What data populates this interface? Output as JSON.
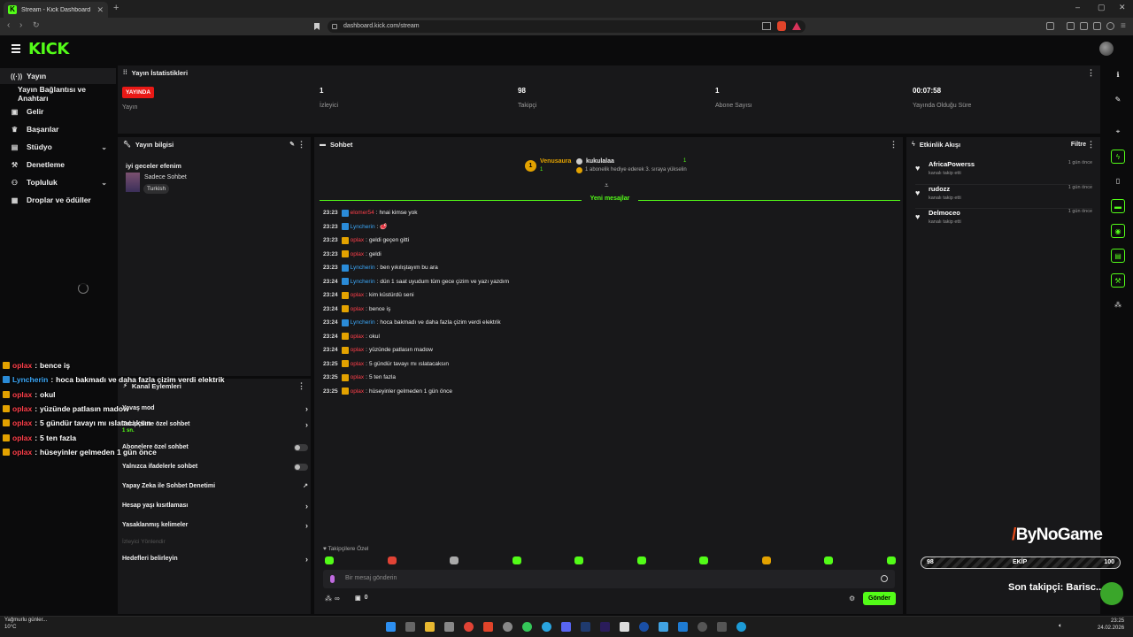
{
  "browser": {
    "tab_title": "Stream - Kick Dashboard",
    "tab_icon": "K",
    "url": "dashboard.kick.com/stream",
    "window_controls": [
      "–",
      "▢",
      "✕"
    ]
  },
  "header": {
    "logo_text": "KICK"
  },
  "sidebar": {
    "items": [
      {
        "label": "Yayın",
        "icon": "((·))"
      },
      {
        "label": "Yayın Bağlantısı ve Anahtarı"
      },
      {
        "label": "Gelir",
        "icon": "▣"
      },
      {
        "label": "Başarılar",
        "icon": "🏆"
      },
      {
        "label": "Stüdyo",
        "icon": "▤"
      },
      {
        "label": "Denetleme",
        "icon": "🔨"
      },
      {
        "label": "Topluluk",
        "icon": "👥"
      },
      {
        "label": "Droplar ve ödüller",
        "icon": "▦"
      }
    ]
  },
  "stats": {
    "title": "Yayın İstatistikleri",
    "live_badge": "YAYINDA",
    "items": [
      {
        "value": "",
        "label": "Yayın"
      },
      {
        "value": "1",
        "label": "İzleyici"
      },
      {
        "value": "98",
        "label": "Takipçi"
      },
      {
        "value": "1",
        "label": "Abone Sayısı"
      },
      {
        "value": "00:07:58",
        "label": "Yayında Olduğu Süre"
      }
    ]
  },
  "stream_info": {
    "title": "Yayın bilgisi",
    "stream_title": "iyi geceler efenim",
    "category": "Sadece Sohbet",
    "tag": "Turkish"
  },
  "actions": {
    "title": "Kanal Eylemleri",
    "items": [
      {
        "label": "Yavaş mod",
        "control": "chevron"
      },
      {
        "label": "Takipçilere özel sohbet",
        "control": "chevron",
        "sub": "1 sn."
      },
      {
        "label": "Abonelere özel sohbet",
        "control": "toggle"
      },
      {
        "label": "Yalnızca ifadelerle sohbet",
        "control": "toggle"
      },
      {
        "label": "Yapay Zeka ile Sohbet Denetimi",
        "control": "external"
      },
      {
        "label": "Hesap yaşı kısıtlaması",
        "control": "chevron"
      },
      {
        "label": "Yasaklanmış kelimeler",
        "control": "chevron"
      },
      {
        "label": "İzleyici Yönlendir",
        "control": "none",
        "disabled": true
      },
      {
        "label": "Hedefleri belirleyin",
        "control": "chevron"
      }
    ]
  },
  "chat": {
    "title": "Sohbet",
    "pinned": {
      "rank": "1",
      "gifter": "Venusaura",
      "gifter_count": "1",
      "recipient": "kukulalaa",
      "recipient_count": "1",
      "text": "1 abonelik hediye ederek 3. sıraya yükselin"
    },
    "new_messages": "Yeni mesajlar",
    "messages": [
      {
        "time": "23:23",
        "user": "elomer54",
        "badge": "sub",
        "color": "red",
        "text": "hnai kimse yok"
      },
      {
        "time": "23:23",
        "user": "Lyncherin",
        "badge": "sub",
        "color": "blue",
        "text": "🥩"
      },
      {
        "time": "23:23",
        "user": "oplax",
        "badge": "crown",
        "color": "red",
        "text": "geldi geçen gitti"
      },
      {
        "time": "23:23",
        "user": "oplax",
        "badge": "crown",
        "color": "red",
        "text": "geldi"
      },
      {
        "time": "23:23",
        "user": "Lyncherin",
        "badge": "sub",
        "color": "blue",
        "text": "ben yıkılıştayım bu ara"
      },
      {
        "time": "23:24",
        "user": "Lyncherin",
        "badge": "sub",
        "color": "blue",
        "text": "dün 1 saat uyudum tüm gece çizim ve yazı yazdım"
      },
      {
        "time": "23:24",
        "user": "oplax",
        "badge": "crown",
        "color": "red",
        "text": "kim küstürdü seni"
      },
      {
        "time": "23:24",
        "user": "oplax",
        "badge": "crown",
        "color": "red",
        "text": "bence iş"
      },
      {
        "time": "23:24",
        "user": "Lyncherin",
        "badge": "sub",
        "color": "blue",
        "text": "hoca bakmadı ve daha fazla çizim verdi elektrik"
      },
      {
        "time": "23:24",
        "user": "oplax",
        "badge": "crown",
        "color": "red",
        "text": "okul"
      },
      {
        "time": "23:24",
        "user": "oplax",
        "badge": "crown",
        "color": "red",
        "text": "yüzünde patlasın madow"
      },
      {
        "time": "23:25",
        "user": "oplax",
        "badge": "crown",
        "color": "red",
        "text": "5 gündür tavayı mı ıslatacaksın"
      },
      {
        "time": "23:25",
        "user": "oplax",
        "badge": "crown",
        "color": "red",
        "text": "5 ten fazla"
      },
      {
        "time": "23:25",
        "user": "oplax",
        "badge": "crown",
        "color": "red",
        "text": "hüseyinler gelmeden 1 gün önce"
      }
    ],
    "emote_label": "Takipçilere Özel",
    "input_placeholder": "Bir mesaj gönderin",
    "send_label": "Gönder",
    "footer_points": "∞",
    "footer_count": "0"
  },
  "events": {
    "title": "Etkinlik Akışı",
    "filter_label": "Filtre",
    "items": [
      {
        "name": "AfricaPowerss",
        "desc": "kanalı takip etti",
        "time": "1 gün önce"
      },
      {
        "name": "rudozz",
        "desc": "kanalı takip etti",
        "time": "1 gün önce"
      },
      {
        "name": "Delmoceo",
        "desc": "kanalı takip etti",
        "time": "1 gün önce"
      }
    ]
  },
  "overlay": {
    "chat": [
      {
        "user": "oplax",
        "badge": "crown",
        "color": "red",
        "text": "bence iş"
      },
      {
        "user": "Lyncherin",
        "badge": "sub",
        "color": "blue",
        "text": "hoca bakmadı ve daha fazla çizim verdi elektrik"
      },
      {
        "user": "oplax",
        "badge": "crown",
        "color": "red",
        "text": "okul"
      },
      {
        "user": "oplax",
        "badge": "crown",
        "color": "red",
        "text": "yüzünde patlasın madow"
      },
      {
        "user": "oplax",
        "badge": "crown",
        "color": "red",
        "text": "5 gündür tavayı mı ıslatacaksın"
      },
      {
        "user": "oplax",
        "badge": "crown",
        "color": "red",
        "text": "5 ten fazla"
      },
      {
        "user": "oplax",
        "badge": "crown",
        "color": "red",
        "text": "hüseyinler gelmeden 1 gün önce"
      }
    ],
    "brand": "ByNoGame",
    "goal_current": "98",
    "goal_label": "EKİP",
    "goal_target": "100",
    "last_follower": "Son takipçi: Barisc..."
  },
  "taskbar": {
    "weather_text": "Yağmurlu günler...",
    "weather_temp": "10°C",
    "time": "23:25",
    "date": "24.02.2026"
  },
  "colors": {
    "brand": "#53fc18",
    "live": "#e91916",
    "red_user": "#ff3f4a",
    "blue_user": "#3ba7f8",
    "crown": "#e3a200"
  }
}
